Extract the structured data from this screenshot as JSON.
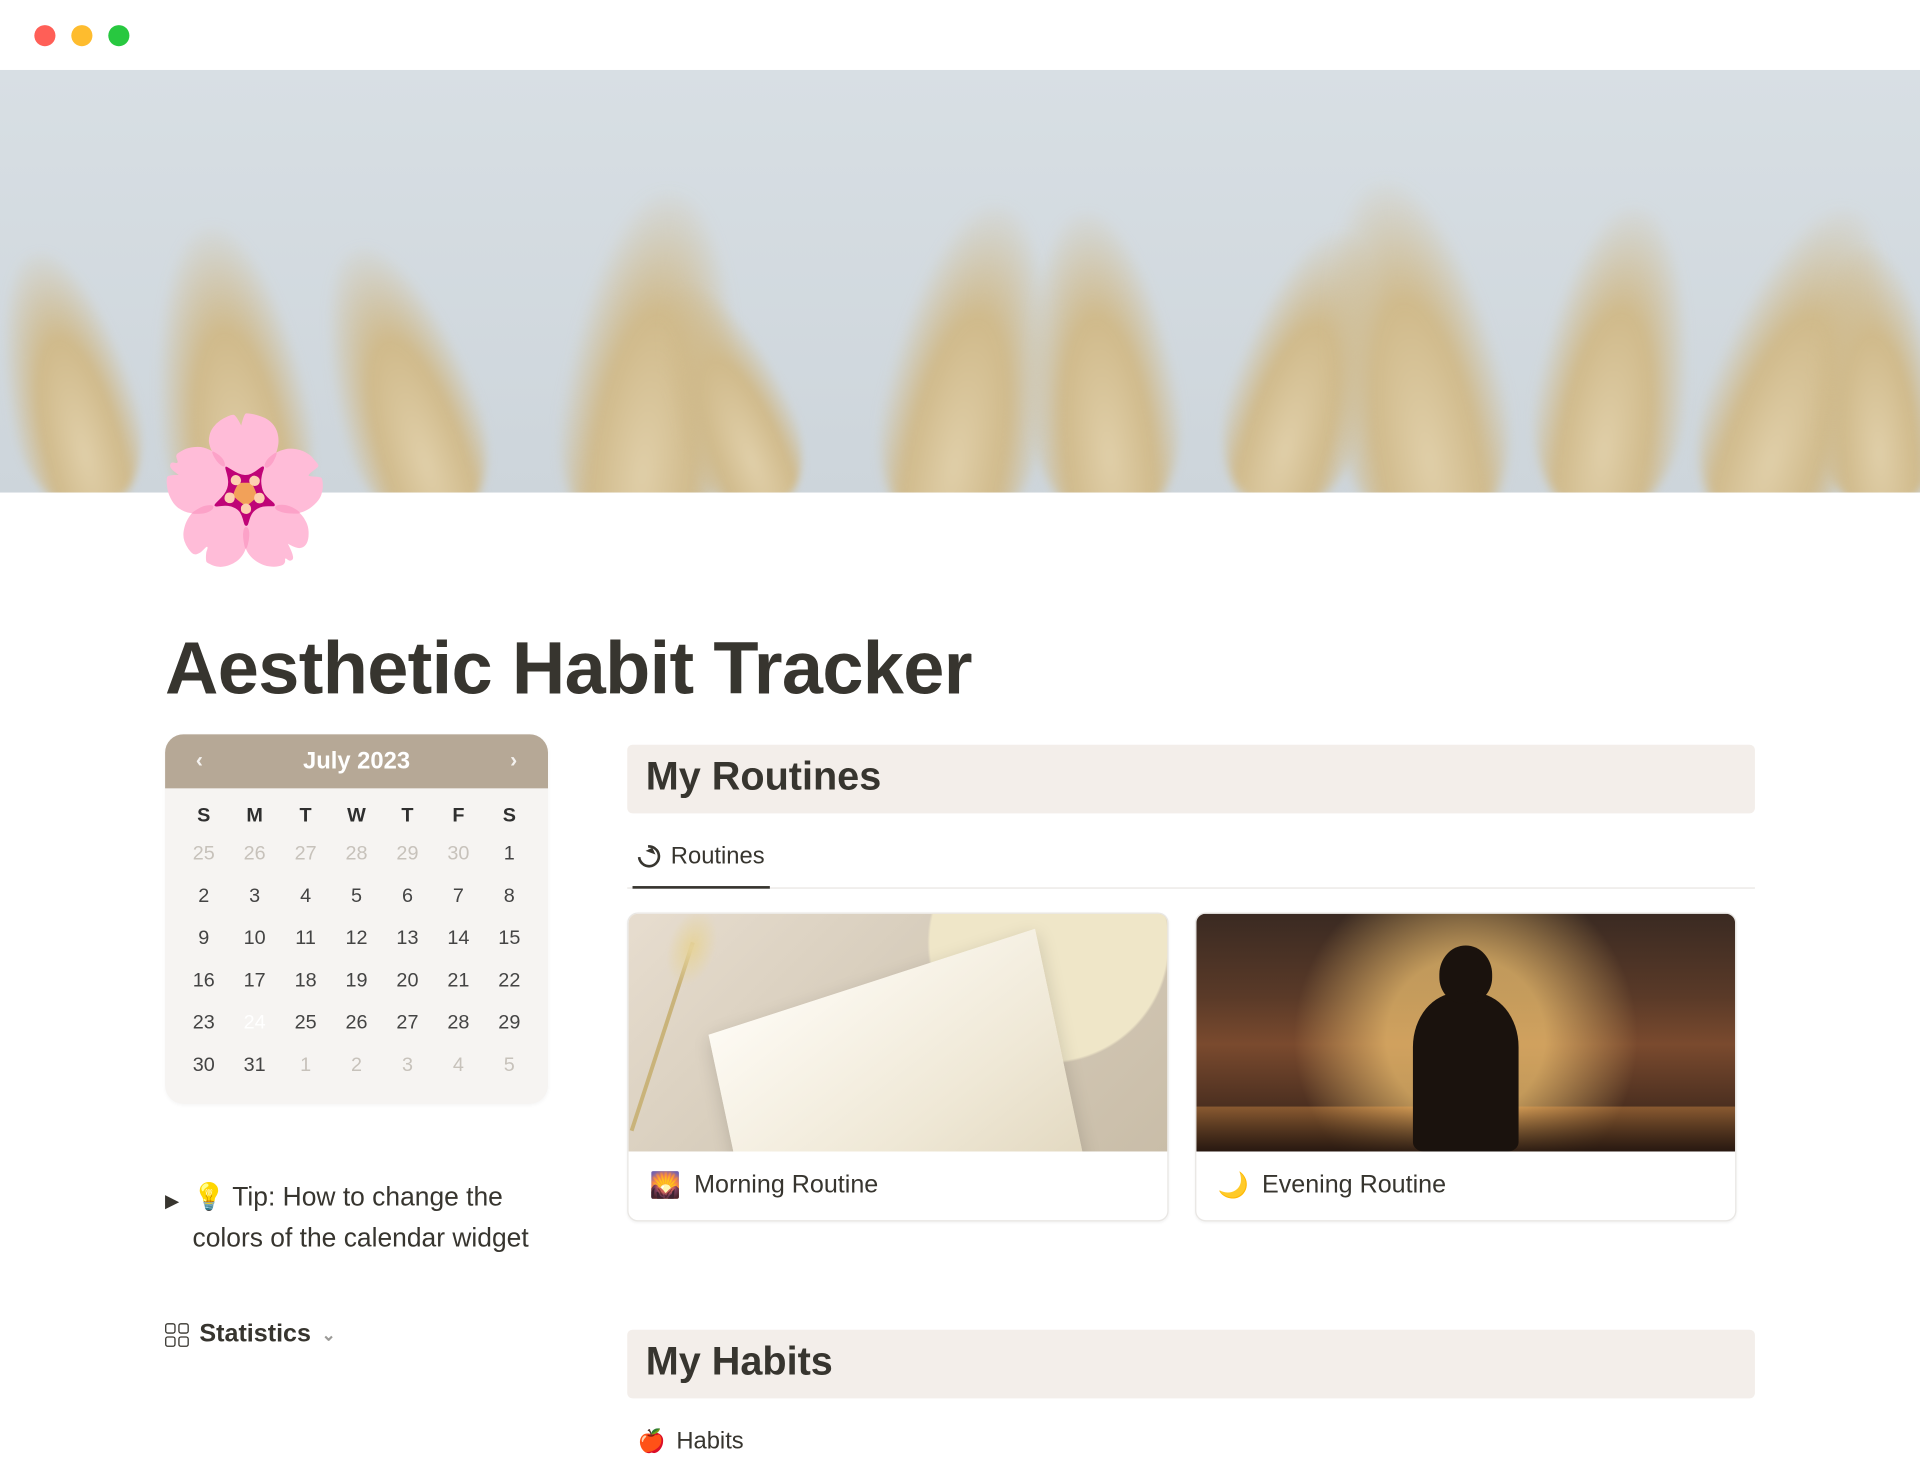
{
  "window": {
    "traffic_lights": [
      "close",
      "minimize",
      "zoom"
    ]
  },
  "page_icon": "🌸",
  "page_title": "Aesthetic Habit Tracker",
  "calendar": {
    "month_label": "July 2023",
    "dow": [
      "S",
      "M",
      "T",
      "W",
      "T",
      "F",
      "S"
    ],
    "leading_muted": [
      25,
      26,
      27,
      28,
      29,
      30
    ],
    "days": [
      1,
      2,
      3,
      4,
      5,
      6,
      7,
      8,
      9,
      10,
      11,
      12,
      13,
      14,
      15,
      16,
      17,
      18,
      19,
      20,
      21,
      22,
      23,
      24,
      25,
      26,
      27,
      28,
      29,
      30,
      31
    ],
    "trailing_muted": [
      1,
      2,
      3,
      4,
      5
    ],
    "today": 24
  },
  "tip": {
    "icon": "💡",
    "text": "Tip: How to change the colors of the calendar widget"
  },
  "stats_link": {
    "label": "Statistics"
  },
  "routines": {
    "heading": "My Routines",
    "tab_label": "Routines",
    "cards": [
      {
        "icon": "🌄",
        "title": "Morning Routine"
      },
      {
        "icon": "🌙",
        "title": "Evening Routine"
      }
    ]
  },
  "habits": {
    "heading": "My Habits",
    "tab_icon": "🍎",
    "tab_label": "Habits"
  }
}
